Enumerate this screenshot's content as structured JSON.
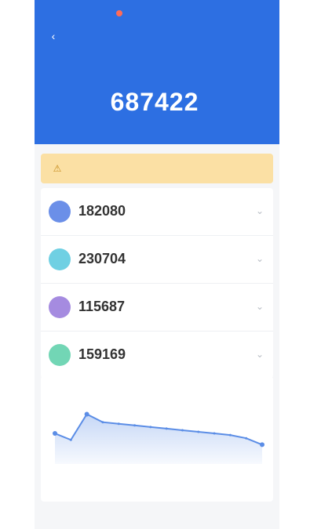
{
  "status_bar": {
    "carrier": "",
    "time": ""
  },
  "nav": {
    "title": ""
  },
  "hero": {
    "label": "",
    "value": "687422",
    "unit": ""
  },
  "notice": {
    "text": ""
  },
  "scores": [
    {
      "value": "182080",
      "unit": "",
      "color": "#6b8fe8"
    },
    {
      "value": "230704",
      "unit": "",
      "color": "#6fd0e3"
    },
    {
      "value": "115687",
      "unit": "",
      "color": "#a58be0"
    },
    {
      "value": "159169",
      "unit": "",
      "color": "#72d6b5"
    }
  ],
  "chart": {
    "title": "",
    "footer_left": "",
    "footer_mid": "",
    "footer_right": ""
  },
  "bottom": {
    "left": "",
    "right": ""
  },
  "chart_data": {
    "type": "area",
    "x": [
      0,
      1,
      2,
      3,
      4,
      5,
      6,
      7,
      8,
      9,
      10,
      11,
      12,
      13
    ],
    "values": [
      38,
      30,
      62,
      52,
      50,
      48,
      46,
      44,
      42,
      40,
      38,
      36,
      32,
      24
    ],
    "ylim": [
      0,
      80
    ],
    "color": "#5b8de6"
  }
}
